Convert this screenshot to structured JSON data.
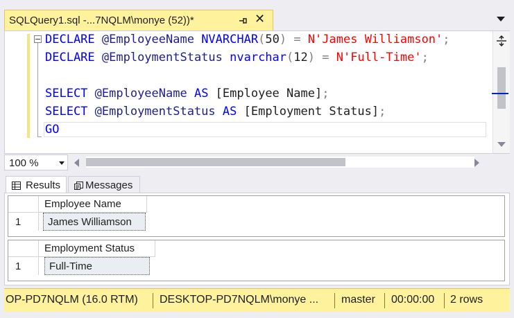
{
  "tab": {
    "title": "SQLQuery1.sql -...7NQLM\\monye (52))*"
  },
  "editor": {
    "lines": [
      [
        {
          "t": "DECLARE",
          "c": "kw"
        },
        {
          "t": " @EmployeeName ",
          "c": "var"
        },
        {
          "t": "NVARCHAR",
          "c": "kw"
        },
        {
          "t": "(",
          "c": "op"
        },
        {
          "t": "50",
          "c": "id"
        },
        {
          "t": ")",
          "c": "op"
        },
        {
          "t": " ",
          "c": "id"
        },
        {
          "t": "=",
          "c": "op"
        },
        {
          "t": " ",
          "c": "id"
        },
        {
          "t": "N'James Williamson'",
          "c": "str"
        },
        {
          "t": ";",
          "c": "op"
        }
      ],
      [
        {
          "t": "DECLARE",
          "c": "kw"
        },
        {
          "t": " @EmploymentStatus ",
          "c": "var"
        },
        {
          "t": "nvarchar",
          "c": "kw"
        },
        {
          "t": "(",
          "c": "op"
        },
        {
          "t": "12",
          "c": "id"
        },
        {
          "t": ")",
          "c": "op"
        },
        {
          "t": " ",
          "c": "id"
        },
        {
          "t": "=",
          "c": "op"
        },
        {
          "t": " ",
          "c": "id"
        },
        {
          "t": "N'Full-Time'",
          "c": "str"
        },
        {
          "t": ";",
          "c": "op"
        }
      ],
      [],
      [
        {
          "t": "SELECT",
          "c": "kw"
        },
        {
          "t": " @EmployeeName ",
          "c": "var"
        },
        {
          "t": "AS",
          "c": "kw"
        },
        {
          "t": " [Employee Name]",
          "c": "id"
        },
        {
          "t": ";",
          "c": "op"
        }
      ],
      [
        {
          "t": "SELECT",
          "c": "kw"
        },
        {
          "t": " @EmploymentStatus ",
          "c": "var"
        },
        {
          "t": "AS",
          "c": "kw"
        },
        {
          "t": " [Employment Status]",
          "c": "id"
        },
        {
          "t": ";",
          "c": "op"
        }
      ],
      [
        {
          "t": "GO",
          "c": "kw"
        }
      ]
    ]
  },
  "zoom": {
    "value": "100 %"
  },
  "results_tabs": {
    "results_label": "Results",
    "messages_label": "Messages"
  },
  "results": [
    {
      "header": "Employee Name",
      "row_number": "1",
      "value": "James Williamson"
    },
    {
      "header": "Employment Status",
      "row_number": "1",
      "value": "Full-Time"
    }
  ],
  "status_bar": {
    "server": "OP-PD7NQLM (16.0 RTM)",
    "user": "DESKTOP-PD7NQLM\\monye ...",
    "database": "master",
    "elapsed": "00:00:00",
    "rows": "2 rows"
  },
  "colors": {
    "tab_yellow": "#fff29d",
    "keyword_blue": "#0000ff",
    "string_red": "#ff0000"
  },
  "icons": [
    "pin-icon",
    "close-icon",
    "dropdown-icon",
    "collapse-icon",
    "split-icon",
    "grid-icon",
    "messages-icon"
  ]
}
